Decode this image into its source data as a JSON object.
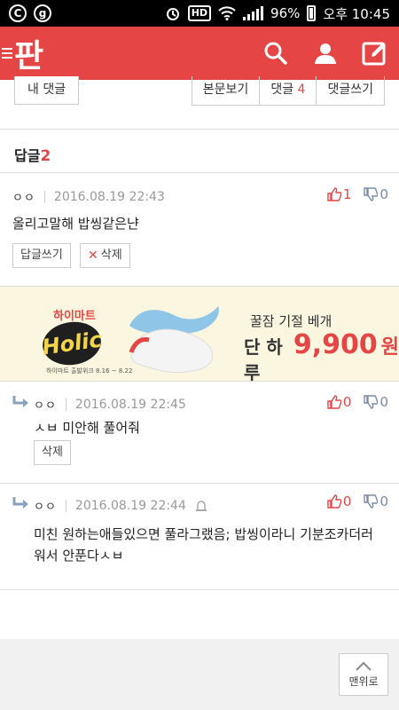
{
  "status_bar": {
    "battery": "96%",
    "time": "오후 10:45",
    "hd": "HD",
    "left_icons": [
      "C",
      "g"
    ]
  },
  "app": {
    "logo": "판"
  },
  "tabs": {
    "my_comments": "내 댓글",
    "view_post": "본문보기",
    "comments_label": "댓글",
    "comments_count": "4",
    "write_comment": "댓글쓰기"
  },
  "replies": {
    "label": "답글",
    "count": "2"
  },
  "comments": [
    {
      "nick": "ㅇㅇ",
      "date": "2016.08.19 22:43",
      "up": "1",
      "down": "0",
      "text": "올리고말해 밥씽같은냔",
      "reply_btn": "답글쓰기",
      "delete_btn": "삭제"
    },
    {
      "nick": "ㅇㅇ",
      "date": "2016.08.19 22:45",
      "up": "0",
      "down": "0",
      "text": "ㅅㅂ 미안해 풀어줘",
      "delete_btn": "삭제"
    },
    {
      "nick": "ㅇㅇ",
      "date": "2016.08.19 22:44",
      "up": "0",
      "down": "0",
      "text_line1": "미친 원하는애들있으면 풀라그랬음; 밥씽이라니 기분조카더러",
      "text_line2": "워서 안푼다ㅅㅂ"
    }
  ],
  "ad": {
    "brand": "하이마트",
    "holic": "Holic",
    "small": "하이마트 출발위크 8.16 ~ 8.22",
    "tagline": "꿀잠 기절 베개",
    "price_prefix": "단 하루",
    "price": "9,900",
    "currency": "원"
  },
  "footer": {
    "top_btn": "맨위로"
  }
}
